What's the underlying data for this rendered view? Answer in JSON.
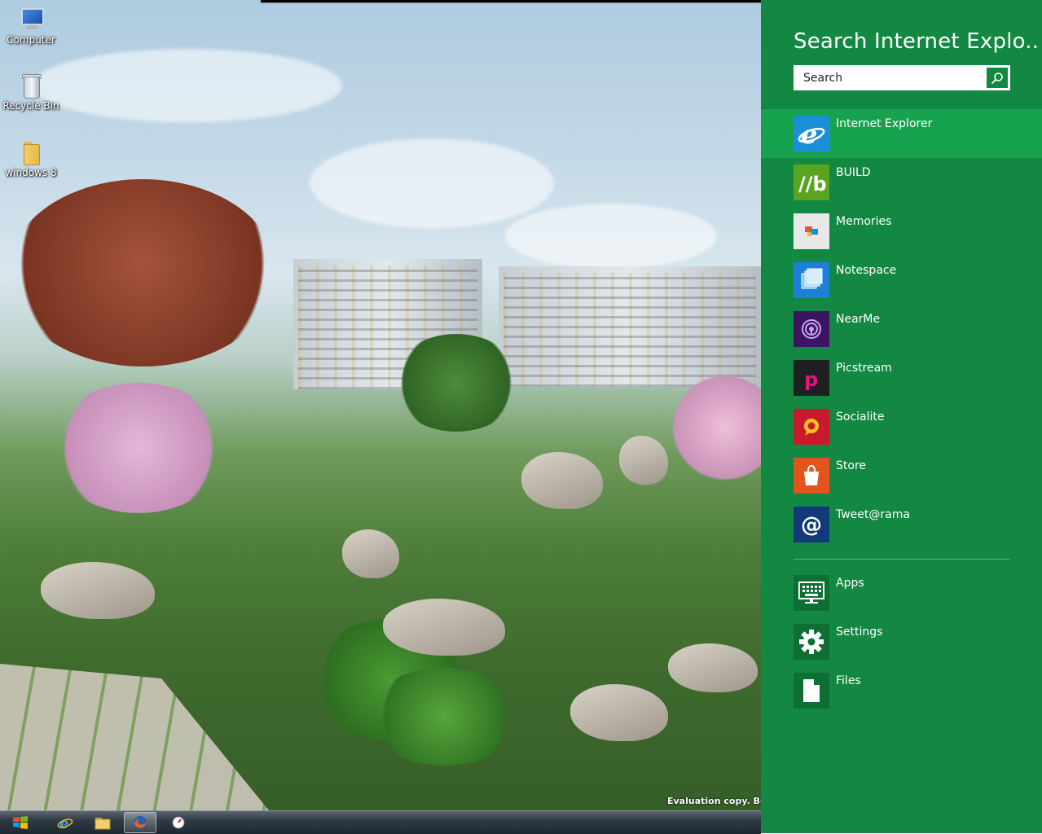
{
  "desktop": {
    "icons": [
      {
        "label": "Computer",
        "icon": "computer-icon"
      },
      {
        "label": "Recycle Bin",
        "icon": "recycle-bin-icon"
      },
      {
        "label": "windows 8",
        "icon": "folder-icon"
      }
    ],
    "watermark": "Evaluation copy. Bu"
  },
  "taskbar": {
    "items": [
      {
        "name": "start-button",
        "icon": "windows-logo-icon"
      },
      {
        "name": "internet-explorer",
        "icon": "internet-explorer-icon"
      },
      {
        "name": "windows-explorer",
        "icon": "folder-icon"
      },
      {
        "name": "firefox",
        "icon": "firefox-icon",
        "active": true
      },
      {
        "name": "app",
        "icon": "gauge-icon"
      }
    ]
  },
  "charm": {
    "title": "Search Internet Explo...",
    "search": {
      "placeholder": "Search",
      "value": ""
    },
    "accent": "#138842",
    "selected_accent": "#17a24f",
    "apps": [
      {
        "label": "Internet Explorer",
        "icon": "internet-explorer-icon",
        "color": "#1a8fd8",
        "selected": true
      },
      {
        "label": "BUILD",
        "icon": "build-icon",
        "color": "#5aa51f"
      },
      {
        "label": "Memories",
        "icon": "memories-icon",
        "color": "#e8e8e8"
      },
      {
        "label": "Notespace",
        "icon": "notespace-icon",
        "color": "#1d7fd6"
      },
      {
        "label": "NearMe",
        "icon": "nearme-icon",
        "color": "#3b1463"
      },
      {
        "label": "Picstream",
        "icon": "picstream-icon",
        "color": "#1f1f1f"
      },
      {
        "label": "Socialite",
        "icon": "socialite-icon",
        "color": "#c81a2e"
      },
      {
        "label": "Store",
        "icon": "store-icon",
        "color": "#e2541b"
      },
      {
        "label": "Tweet@rama",
        "icon": "tweetarama-icon",
        "color": "#123a78"
      }
    ],
    "filters": [
      {
        "label": "Apps",
        "icon": "apps-icon"
      },
      {
        "label": "Settings",
        "icon": "settings-icon"
      },
      {
        "label": "Files",
        "icon": "files-icon"
      }
    ]
  }
}
